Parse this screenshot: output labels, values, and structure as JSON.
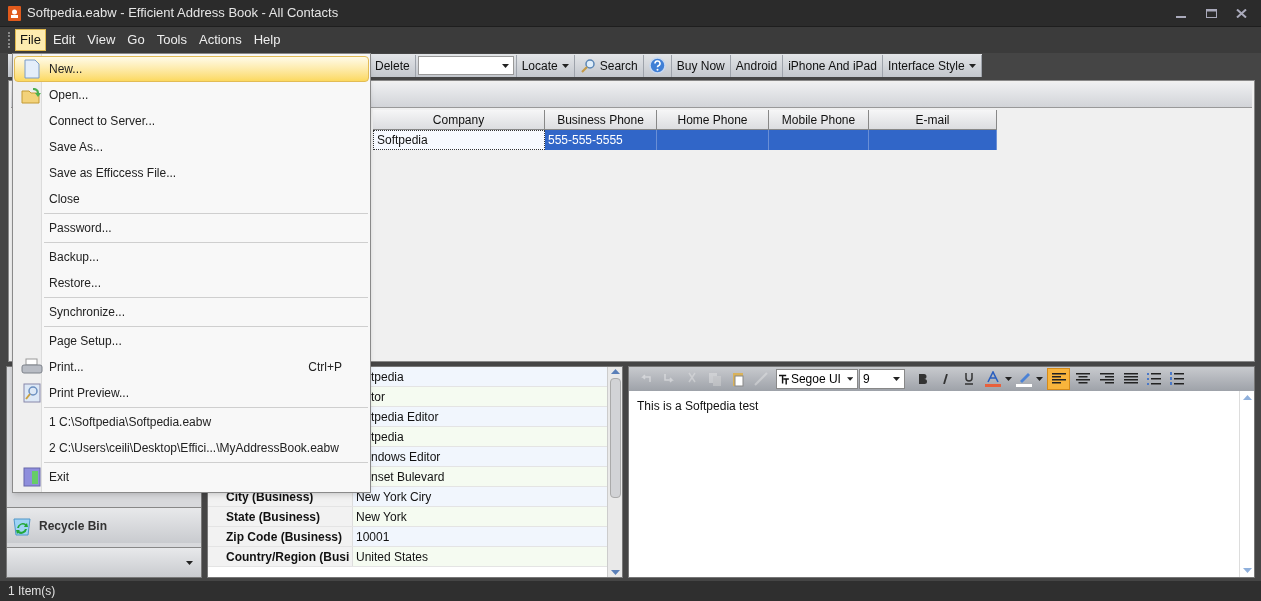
{
  "window": {
    "title": "Softpedia.eabw - Efficient Address Book - All Contacts"
  },
  "menu_bar": [
    {
      "label": "File",
      "selected": true
    },
    {
      "label": "Edit",
      "selected": false
    },
    {
      "label": "View",
      "selected": false
    },
    {
      "label": "Go",
      "selected": false
    },
    {
      "label": "Tools",
      "selected": false
    },
    {
      "label": "Actions",
      "selected": false
    },
    {
      "label": "Help",
      "selected": false
    }
  ],
  "file_menu": [
    {
      "kind": "item",
      "label": "New...",
      "highlighted": true
    },
    {
      "kind": "item",
      "label": "Open...",
      "highlighted": false
    },
    {
      "kind": "item",
      "label": "Connect to Server...",
      "highlighted": false
    },
    {
      "kind": "item",
      "label": "Save As...",
      "highlighted": false
    },
    {
      "kind": "item",
      "label": "Save as Efficcess File...",
      "highlighted": false
    },
    {
      "kind": "item",
      "label": "Close",
      "highlighted": false
    },
    {
      "kind": "separator"
    },
    {
      "kind": "item",
      "label": "Password...",
      "highlighted": false
    },
    {
      "kind": "separator"
    },
    {
      "kind": "item",
      "label": "Backup...",
      "highlighted": false
    },
    {
      "kind": "item",
      "label": "Restore...",
      "highlighted": false
    },
    {
      "kind": "separator"
    },
    {
      "kind": "item",
      "label": "Synchronize...",
      "highlighted": false
    },
    {
      "kind": "separator"
    },
    {
      "kind": "item",
      "label": "Page Setup...",
      "highlighted": false
    },
    {
      "kind": "item",
      "label": "Print...",
      "shortcut": "Ctrl+P",
      "highlighted": false
    },
    {
      "kind": "item",
      "label": "Print Preview...",
      "highlighted": false
    },
    {
      "kind": "separator"
    },
    {
      "kind": "item",
      "label": "1 C:\\Softpedia\\Softpedia.eabw",
      "highlighted": false
    },
    {
      "kind": "item",
      "label": "2 C:\\Users\\ceili\\Desktop\\Effici...\\MyAddressBook.eabw",
      "highlighted": false
    },
    {
      "kind": "separator"
    },
    {
      "kind": "item",
      "label": "Exit",
      "highlighted": false
    }
  ],
  "toolbar": [
    {
      "kind": "button",
      "label": "Delete"
    },
    {
      "kind": "combo"
    },
    {
      "kind": "dropdown",
      "label": "Locate"
    },
    {
      "kind": "search",
      "label": "Search"
    },
    {
      "kind": "help"
    },
    {
      "kind": "button",
      "label": "Buy Now"
    },
    {
      "kind": "button",
      "label": "Android"
    },
    {
      "kind": "button",
      "label": "iPhone And iPad"
    },
    {
      "kind": "dropdown",
      "label": "Interface Style"
    }
  ],
  "table": {
    "columns": [
      "Company",
      "Business Phone",
      "Home Phone",
      "Mobile Phone",
      "E-mail"
    ],
    "rows": [
      {
        "cells": [
          "Softpedia",
          "555-555-5555",
          "",
          "",
          ""
        ],
        "selected": true
      }
    ]
  },
  "details": [
    {
      "value": "tpedia"
    },
    {
      "value": "tor"
    },
    {
      "value": "tpedia Editor"
    },
    {
      "value": "tpedia"
    },
    {
      "value": "ndows Editor"
    },
    {
      "value": "nset Bulevard"
    },
    {
      "label": "City (Business)",
      "value": "New York Ciry"
    },
    {
      "label": "State (Business)",
      "value": "New York"
    },
    {
      "label": "Zip Code (Business)",
      "value": "10001"
    },
    {
      "label": "Country/Region (Busi",
      "value": "United States"
    }
  ],
  "sidebar": {
    "items": [
      {
        "label": "Recycle Bin"
      }
    ]
  },
  "editor": {
    "font": "Segoe UI",
    "size": "9",
    "undo_disabled": true,
    "align": [
      {
        "selected": true
      },
      {
        "selected": false
      },
      {
        "selected": false
      },
      {
        "selected": false
      }
    ],
    "text": "This is a Softpedia test"
  },
  "status_bar": "1 Item(s)"
}
